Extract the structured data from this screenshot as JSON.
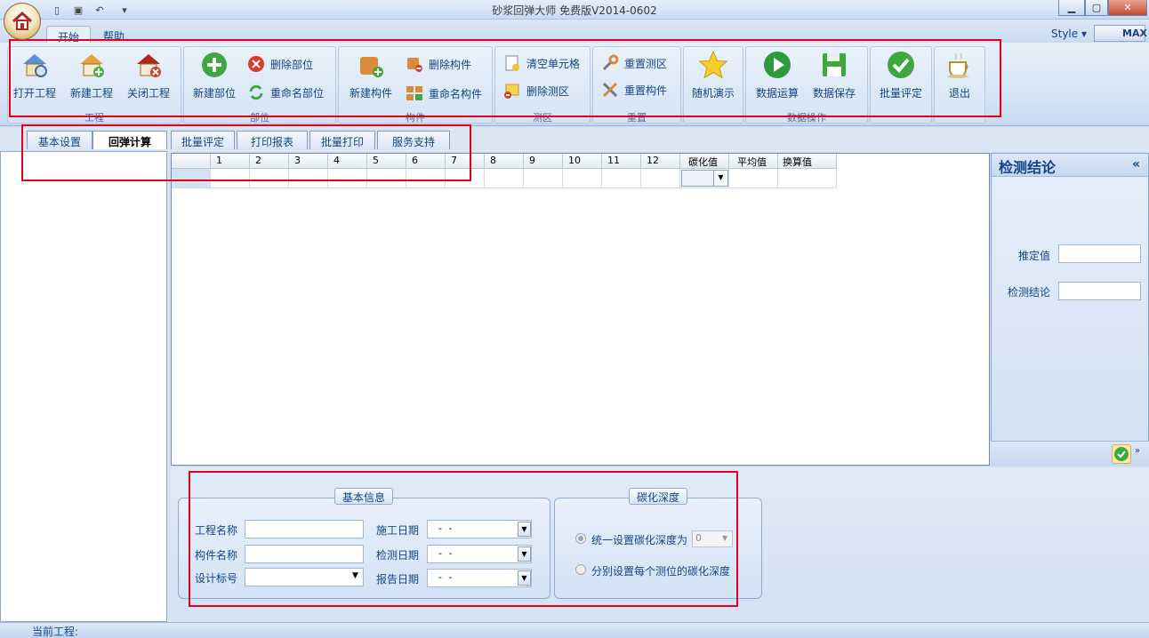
{
  "app": {
    "title": "砂浆回弹大师 免费版V2014-0602"
  },
  "quick_access": {
    "icons": [
      "new-file-icon",
      "save-icon",
      "undo-icon",
      "customize-icon"
    ]
  },
  "menu_tabs": [
    "开始",
    "帮助"
  ],
  "style_menu": {
    "label": "Style",
    "theme": "MAX"
  },
  "ribbon": {
    "groups": [
      {
        "title": "工程",
        "buttons": [
          "打开工程",
          "新建工程",
          "关闭工程"
        ]
      },
      {
        "title": "部位",
        "buttons": [
          "新建部位",
          "删除部位",
          "重命名部位"
        ]
      },
      {
        "title": "构件",
        "buttons": [
          "新建构件",
          "删除构件",
          "重命名构件"
        ]
      },
      {
        "title": "测区",
        "buttons": [
          "清空单元格",
          "删除测区"
        ]
      },
      {
        "title": "重置",
        "buttons": [
          "重置测区",
          "重置构件"
        ]
      },
      {
        "title": "",
        "buttons": [
          "随机演示"
        ]
      },
      {
        "title": "数据操作",
        "buttons": [
          "数据运算",
          "数据保存"
        ]
      },
      {
        "title": "",
        "buttons": [
          "批量评定"
        ]
      },
      {
        "title": "",
        "buttons": [
          "退出"
        ]
      }
    ]
  },
  "doc_tabs": [
    "基本设置",
    "回弹计算",
    "批量评定",
    "打印报表",
    "批量打印",
    "服务支持"
  ],
  "grid": {
    "columns": [
      "",
      "1",
      "2",
      "3",
      "4",
      "5",
      "6",
      "7",
      "8",
      "9",
      "10",
      "11",
      "12",
      "碳化值",
      "平均值",
      "换算值"
    ]
  },
  "conclusion_panel": {
    "title": "检测结论",
    "collapse": "«",
    "fields": [
      {
        "label": "推定值",
        "value": ""
      },
      {
        "label": "检测结论",
        "value": ""
      }
    ]
  },
  "basic_info": {
    "legend": "基本信息",
    "fields": [
      {
        "label": "工程名称",
        "value": ""
      },
      {
        "label": "构件名称",
        "value": ""
      },
      {
        "label": "设计标号",
        "value": ""
      }
    ],
    "dates": [
      {
        "label": "施工日期",
        "value": "-  -"
      },
      {
        "label": "检测日期",
        "value": "-  -"
      },
      {
        "label": "报告日期",
        "value": "-  -"
      }
    ]
  },
  "carbonation": {
    "legend": "碳化深度",
    "option_uniform": "统一设置碳化深度为",
    "uniform_value": "0",
    "option_each": "分别设置每个测位的碳化深度",
    "selected": "uniform"
  },
  "status": {
    "current_project_label": "当前工程:"
  }
}
